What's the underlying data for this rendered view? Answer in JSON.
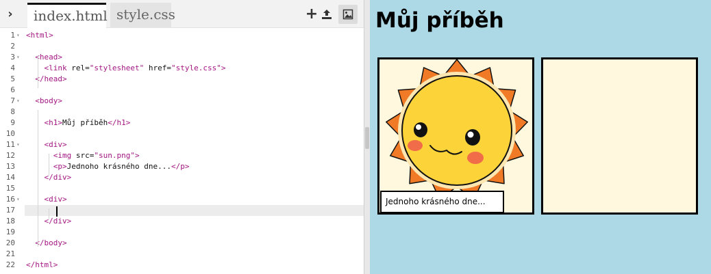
{
  "editor": {
    "tabs": [
      {
        "label": "index.html",
        "active": true
      },
      {
        "label": "style.css",
        "active": false
      }
    ],
    "toolbar": {
      "toggle_icon": "chevron-right-icon",
      "add_icon": "plus-icon",
      "upload_icon": "upload-icon",
      "image_icon": "image-icon"
    },
    "line_numbers": [
      "1",
      "2",
      "3",
      "4",
      "5",
      "6",
      "7",
      "8",
      "9",
      "10",
      "11",
      "12",
      "13",
      "14",
      "15",
      "16",
      "17",
      "18",
      "19",
      "20",
      "21",
      "22"
    ],
    "fold_markers": {
      "1": "▾",
      "3": "▾",
      "7": "▾",
      "11": "▾",
      "16": "▾"
    },
    "code": [
      "<html>",
      "",
      "  <head>",
      "    <link rel=\"stylesheet\" href=\"style.css\">",
      "  </head>",
      "",
      "  <body>",
      "",
      "    <h1>Můj příběh</h1>",
      "",
      "    <div>",
      "      <img src=\"sun.png\">",
      "      <p>Jednoho krásného dne...</p>",
      "    </div>",
      "",
      "    <div>",
      "",
      "    </div>",
      "",
      "  </body>",
      "",
      "</html>"
    ],
    "current_line": 17
  },
  "preview": {
    "title": "Můj příběh",
    "panels": [
      {
        "image": "sun-cartoon",
        "caption": "Jednoho krásného dne..."
      },
      {
        "image": "",
        "caption": ""
      }
    ],
    "colors": {
      "background": "#add8e6",
      "panel": "#fff8de",
      "tag": "#a31581"
    }
  }
}
